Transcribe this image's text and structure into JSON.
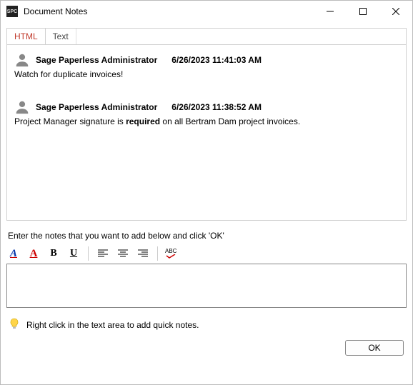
{
  "window": {
    "title": "Document Notes"
  },
  "tabs": {
    "html": "HTML",
    "text": "Text"
  },
  "notes": [
    {
      "author": "Sage Paperless Administrator",
      "timestamp": "6/26/2023 11:41:03 AM",
      "body_plain": "Watch for duplicate invoices!"
    },
    {
      "author": "Sage Paperless Administrator",
      "timestamp": "6/26/2023 11:38:52 AM",
      "body_prefix": "Project Manager signature is ",
      "body_bold": "required",
      "body_suffix": " on all Bertram Dam project invoices."
    }
  ],
  "instruction": "Enter the notes that you want to add below and click 'OK'",
  "toolbar": {
    "bgcolor_glyph": "A",
    "fgcolor_glyph": "A",
    "bold_glyph": "B",
    "underline_glyph": "U",
    "spellcheck_glyph": "ABC"
  },
  "editor": {
    "value": ""
  },
  "tip": "Right click in the text area to add quick notes.",
  "buttons": {
    "ok": "OK"
  }
}
